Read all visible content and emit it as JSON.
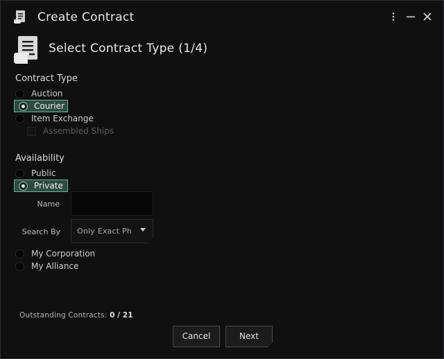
{
  "window": {
    "title": "Create Contract",
    "title_icon": "contract-scroll-icon",
    "controls": {
      "menu_icon": "kebab-menu-icon",
      "minimize_icon": "minimize-icon",
      "close_icon": "close-icon"
    }
  },
  "header": {
    "icon": "contract-document-icon",
    "text": "Select Contract Type (1/4)"
  },
  "contract_type": {
    "label": "Contract Type",
    "options": [
      {
        "label": "Auction",
        "checked": false
      },
      {
        "label": "Courier",
        "checked": true
      },
      {
        "label": "Item Exchange",
        "checked": false
      }
    ],
    "assembled_ships": {
      "label": "Assembled Ships",
      "checked": false,
      "enabled": false
    }
  },
  "availability": {
    "label": "Availability",
    "options": [
      {
        "label": "Public",
        "checked": false
      },
      {
        "label": "Private",
        "checked": true
      }
    ],
    "name_field": {
      "label": "Name",
      "value": ""
    },
    "search_by": {
      "label": "Search By",
      "value": "Only Exact Phrase"
    },
    "extra_options": [
      {
        "label": "My Corporation",
        "checked": false
      },
      {
        "label": "My Alliance",
        "checked": false
      }
    ]
  },
  "outstanding": {
    "label": "Outstanding Contracts:",
    "current": "0",
    "separator": "/",
    "max": "21"
  },
  "buttons": {
    "cancel": "Cancel",
    "next": "Next"
  },
  "colors": {
    "selected_bg": "#2f4a41",
    "selected_border": "#6fb397",
    "window_bg": "#101011"
  }
}
